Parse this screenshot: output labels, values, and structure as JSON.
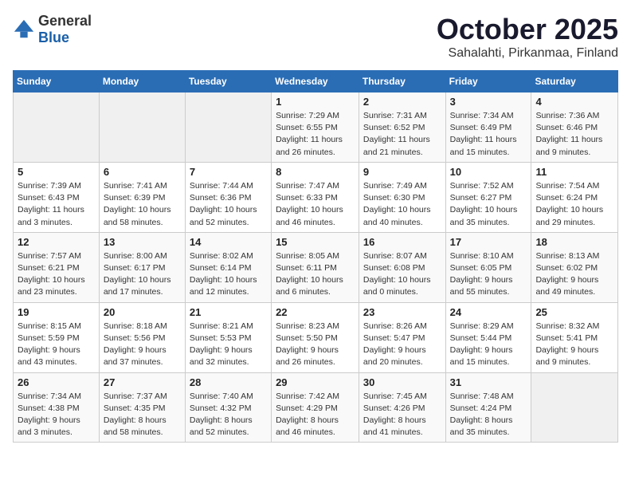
{
  "header": {
    "logo_general": "General",
    "logo_blue": "Blue",
    "month": "October 2025",
    "location": "Sahalahti, Pirkanmaa, Finland"
  },
  "weekdays": [
    "Sunday",
    "Monday",
    "Tuesday",
    "Wednesday",
    "Thursday",
    "Friday",
    "Saturday"
  ],
  "weeks": [
    [
      {
        "day": "",
        "sunrise": "",
        "sunset": "",
        "daylight": ""
      },
      {
        "day": "",
        "sunrise": "",
        "sunset": "",
        "daylight": ""
      },
      {
        "day": "",
        "sunrise": "",
        "sunset": "",
        "daylight": ""
      },
      {
        "day": "1",
        "sunrise": "Sunrise: 7:29 AM",
        "sunset": "Sunset: 6:55 PM",
        "daylight": "Daylight: 11 hours and 26 minutes."
      },
      {
        "day": "2",
        "sunrise": "Sunrise: 7:31 AM",
        "sunset": "Sunset: 6:52 PM",
        "daylight": "Daylight: 11 hours and 21 minutes."
      },
      {
        "day": "3",
        "sunrise": "Sunrise: 7:34 AM",
        "sunset": "Sunset: 6:49 PM",
        "daylight": "Daylight: 11 hours and 15 minutes."
      },
      {
        "day": "4",
        "sunrise": "Sunrise: 7:36 AM",
        "sunset": "Sunset: 6:46 PM",
        "daylight": "Daylight: 11 hours and 9 minutes."
      }
    ],
    [
      {
        "day": "5",
        "sunrise": "Sunrise: 7:39 AM",
        "sunset": "Sunset: 6:43 PM",
        "daylight": "Daylight: 11 hours and 3 minutes."
      },
      {
        "day": "6",
        "sunrise": "Sunrise: 7:41 AM",
        "sunset": "Sunset: 6:39 PM",
        "daylight": "Daylight: 10 hours and 58 minutes."
      },
      {
        "day": "7",
        "sunrise": "Sunrise: 7:44 AM",
        "sunset": "Sunset: 6:36 PM",
        "daylight": "Daylight: 10 hours and 52 minutes."
      },
      {
        "day": "8",
        "sunrise": "Sunrise: 7:47 AM",
        "sunset": "Sunset: 6:33 PM",
        "daylight": "Daylight: 10 hours and 46 minutes."
      },
      {
        "day": "9",
        "sunrise": "Sunrise: 7:49 AM",
        "sunset": "Sunset: 6:30 PM",
        "daylight": "Daylight: 10 hours and 40 minutes."
      },
      {
        "day": "10",
        "sunrise": "Sunrise: 7:52 AM",
        "sunset": "Sunset: 6:27 PM",
        "daylight": "Daylight: 10 hours and 35 minutes."
      },
      {
        "day": "11",
        "sunrise": "Sunrise: 7:54 AM",
        "sunset": "Sunset: 6:24 PM",
        "daylight": "Daylight: 10 hours and 29 minutes."
      }
    ],
    [
      {
        "day": "12",
        "sunrise": "Sunrise: 7:57 AM",
        "sunset": "Sunset: 6:21 PM",
        "daylight": "Daylight: 10 hours and 23 minutes."
      },
      {
        "day": "13",
        "sunrise": "Sunrise: 8:00 AM",
        "sunset": "Sunset: 6:17 PM",
        "daylight": "Daylight: 10 hours and 17 minutes."
      },
      {
        "day": "14",
        "sunrise": "Sunrise: 8:02 AM",
        "sunset": "Sunset: 6:14 PM",
        "daylight": "Daylight: 10 hours and 12 minutes."
      },
      {
        "day": "15",
        "sunrise": "Sunrise: 8:05 AM",
        "sunset": "Sunset: 6:11 PM",
        "daylight": "Daylight: 10 hours and 6 minutes."
      },
      {
        "day": "16",
        "sunrise": "Sunrise: 8:07 AM",
        "sunset": "Sunset: 6:08 PM",
        "daylight": "Daylight: 10 hours and 0 minutes."
      },
      {
        "day": "17",
        "sunrise": "Sunrise: 8:10 AM",
        "sunset": "Sunset: 6:05 PM",
        "daylight": "Daylight: 9 hours and 55 minutes."
      },
      {
        "day": "18",
        "sunrise": "Sunrise: 8:13 AM",
        "sunset": "Sunset: 6:02 PM",
        "daylight": "Daylight: 9 hours and 49 minutes."
      }
    ],
    [
      {
        "day": "19",
        "sunrise": "Sunrise: 8:15 AM",
        "sunset": "Sunset: 5:59 PM",
        "daylight": "Daylight: 9 hours and 43 minutes."
      },
      {
        "day": "20",
        "sunrise": "Sunrise: 8:18 AM",
        "sunset": "Sunset: 5:56 PM",
        "daylight": "Daylight: 9 hours and 37 minutes."
      },
      {
        "day": "21",
        "sunrise": "Sunrise: 8:21 AM",
        "sunset": "Sunset: 5:53 PM",
        "daylight": "Daylight: 9 hours and 32 minutes."
      },
      {
        "day": "22",
        "sunrise": "Sunrise: 8:23 AM",
        "sunset": "Sunset: 5:50 PM",
        "daylight": "Daylight: 9 hours and 26 minutes."
      },
      {
        "day": "23",
        "sunrise": "Sunrise: 8:26 AM",
        "sunset": "Sunset: 5:47 PM",
        "daylight": "Daylight: 9 hours and 20 minutes."
      },
      {
        "day": "24",
        "sunrise": "Sunrise: 8:29 AM",
        "sunset": "Sunset: 5:44 PM",
        "daylight": "Daylight: 9 hours and 15 minutes."
      },
      {
        "day": "25",
        "sunrise": "Sunrise: 8:32 AM",
        "sunset": "Sunset: 5:41 PM",
        "daylight": "Daylight: 9 hours and 9 minutes."
      }
    ],
    [
      {
        "day": "26",
        "sunrise": "Sunrise: 7:34 AM",
        "sunset": "Sunset: 4:38 PM",
        "daylight": "Daylight: 9 hours and 3 minutes."
      },
      {
        "day": "27",
        "sunrise": "Sunrise: 7:37 AM",
        "sunset": "Sunset: 4:35 PM",
        "daylight": "Daylight: 8 hours and 58 minutes."
      },
      {
        "day": "28",
        "sunrise": "Sunrise: 7:40 AM",
        "sunset": "Sunset: 4:32 PM",
        "daylight": "Daylight: 8 hours and 52 minutes."
      },
      {
        "day": "29",
        "sunrise": "Sunrise: 7:42 AM",
        "sunset": "Sunset: 4:29 PM",
        "daylight": "Daylight: 8 hours and 46 minutes."
      },
      {
        "day": "30",
        "sunrise": "Sunrise: 7:45 AM",
        "sunset": "Sunset: 4:26 PM",
        "daylight": "Daylight: 8 hours and 41 minutes."
      },
      {
        "day": "31",
        "sunrise": "Sunrise: 7:48 AM",
        "sunset": "Sunset: 4:24 PM",
        "daylight": "Daylight: 8 hours and 35 minutes."
      },
      {
        "day": "",
        "sunrise": "",
        "sunset": "",
        "daylight": ""
      }
    ]
  ]
}
